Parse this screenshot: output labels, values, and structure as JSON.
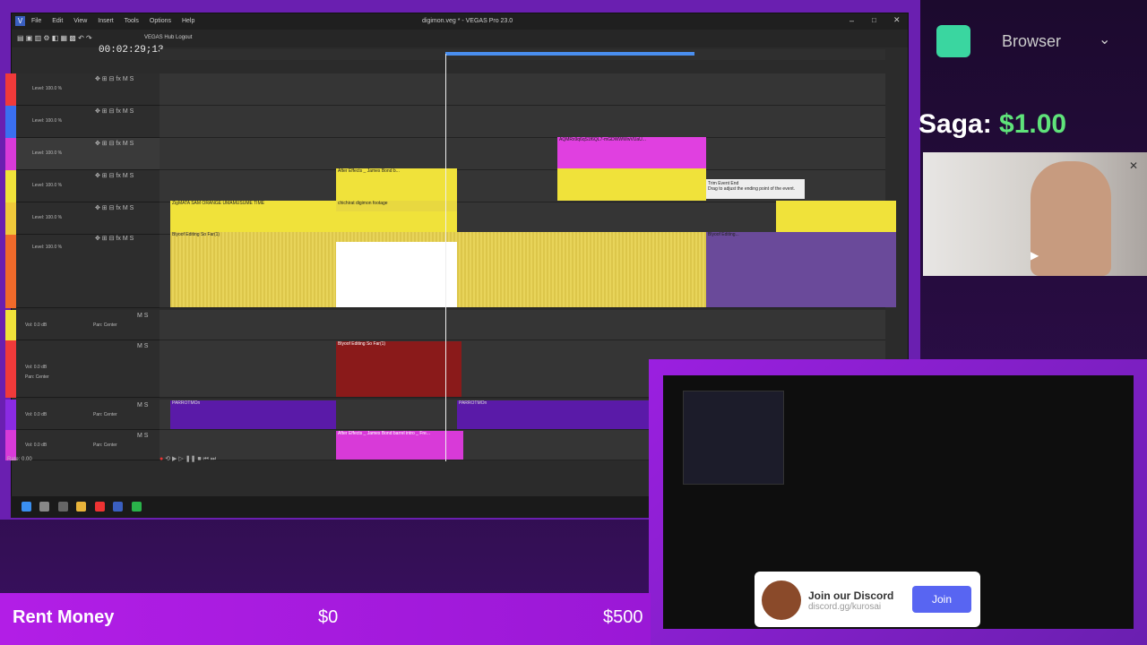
{
  "window": {
    "title": "digimon.veg * - VEGAS Pro 23.0",
    "menu": [
      "File",
      "Edit",
      "View",
      "Insert",
      "Tools",
      "Options",
      "Help"
    ],
    "hub_link": "VEGAS Hub Logout"
  },
  "timeline": {
    "timecode": "00:02:29;13",
    "tracks": [
      {
        "level": "Level: 100.0 %",
        "color": "#f03a3a"
      },
      {
        "level": "Level: 100.0 %",
        "color": "#3a6ff0"
      },
      {
        "level": "Level: 100.0 %",
        "color": "#d83ad8"
      },
      {
        "level": "Level: 100.0 %",
        "color": "#f0e23a"
      },
      {
        "level": "Level: 100.0 %",
        "color": "#f0c93a"
      },
      {
        "level": "Level: 100.0 %",
        "color": "#f06a2a"
      }
    ],
    "audio_tracks": [
      {
        "vol": "0.0 dB",
        "pan": "Center"
      },
      {
        "vol": "0.0 dB",
        "pan": "Center"
      },
      {
        "vol": "0.0 dB",
        "pan": "Center"
      },
      {
        "vol": "0.0 dB",
        "pan": "Center"
      }
    ],
    "clips": {
      "c1": "AQMRx9q6qS1f6QL7-mGDWWWwVUaU...",
      "c2": "After Effects _ James Bond b...",
      "c3": "ZigMATA SAM  ORANGE  UMAMUSUME TIME",
      "c4": "chichirat digimon footage",
      "c5": "Blyoof Editing So Far(1)",
      "c6": "Blyoof Editing...",
      "c7": "Blyoof Editing So Far(1)",
      "c8": "PARROTMOn",
      "c9": "PARROTMOn",
      "c10": "After Effects _ James Bond barrel intro _ Fre..."
    },
    "tooltip_title": "Trim Event End",
    "tooltip_body": "Drag to adjust the ending point of the event.",
    "rate": "Rate: 0.00",
    "mute_solo": "M S"
  },
  "overlay": {
    "browser_label": "Browser",
    "saga_label": "Saga:",
    "saga_amount": "$1.00",
    "discord_title": "Join our Discord",
    "discord_sub": "discord.gg/kurosai",
    "join_label": "Join",
    "rent_label": "Rent Money",
    "rent_current": "$0",
    "rent_goal": "$500"
  },
  "colors": {
    "accent": "#8a2be2",
    "yellow": "#f0e23a",
    "magenta": "#e040e0",
    "audio_red": "#8a1a1a",
    "audio_purple": "#5a1aa8"
  }
}
